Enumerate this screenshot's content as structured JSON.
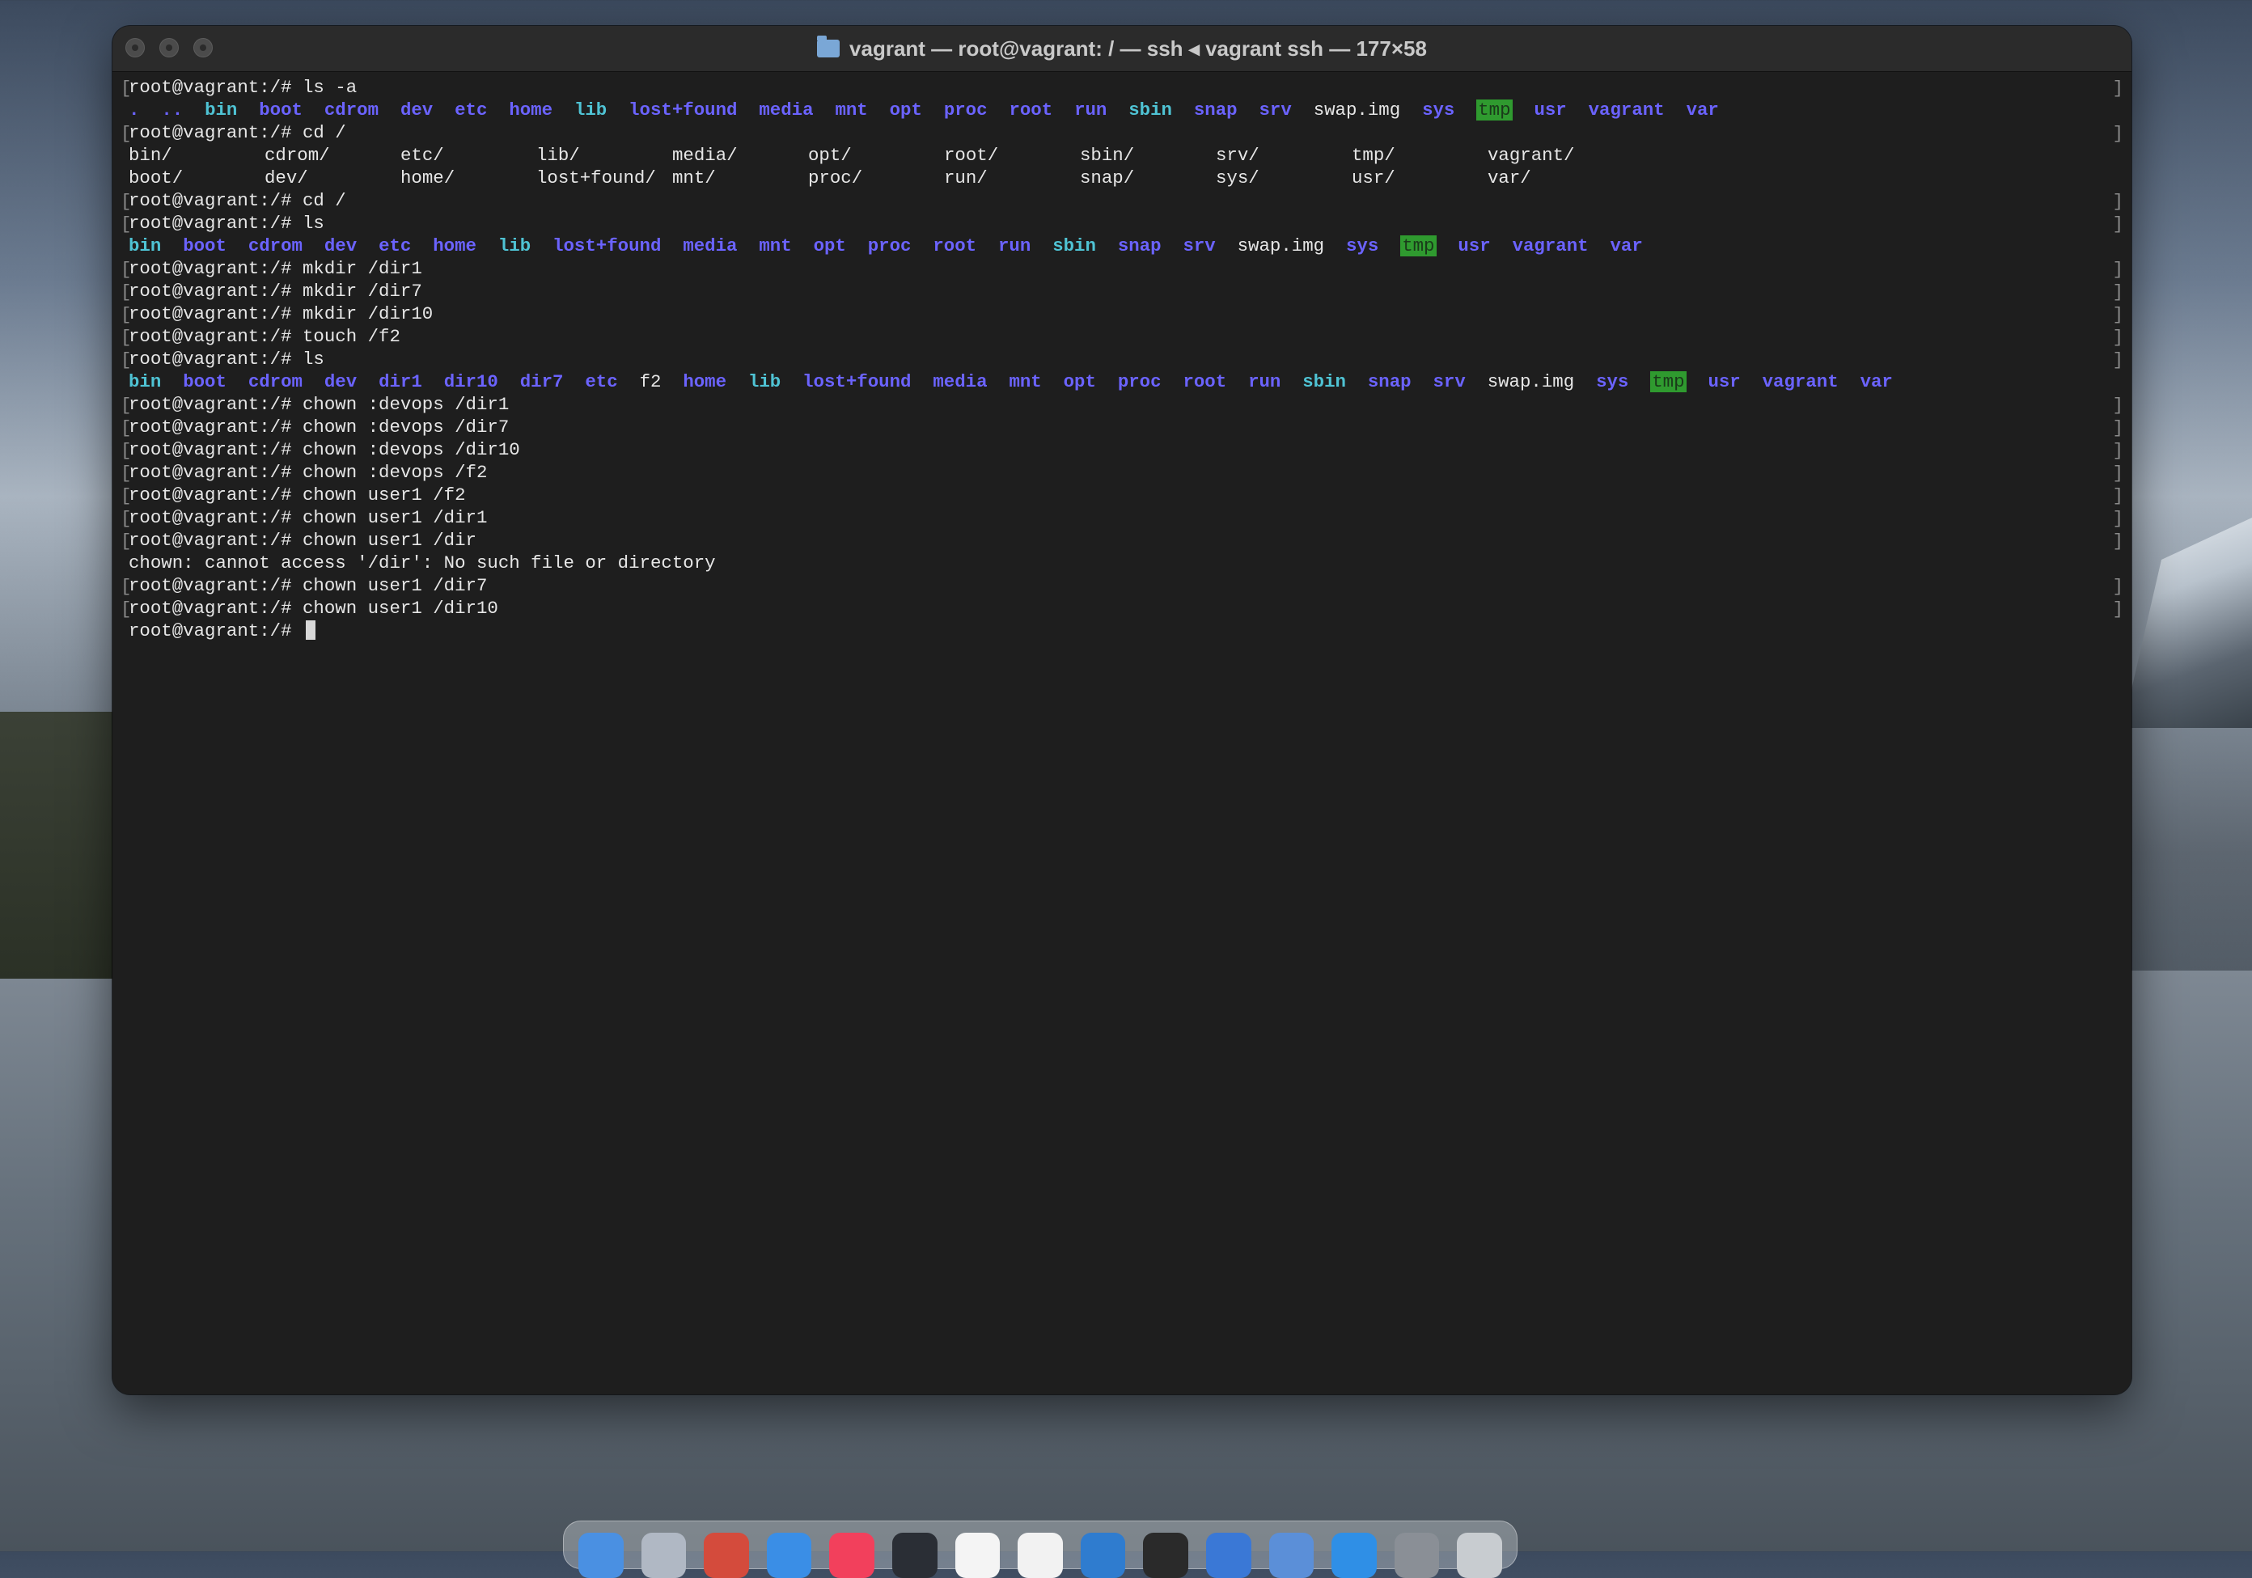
{
  "window": {
    "title": "vagrant — root@vagrant: / — ssh ◂ vagrant ssh — 177×58"
  },
  "terminal": {
    "lines": [
      {
        "text": "root@vagrant:/# ls -a"
      },
      {
        "entries": [
          {
            "t": ".",
            "c": "dir"
          },
          {
            "t": "..",
            "c": "dir"
          },
          {
            "t": "bin",
            "c": "cy"
          },
          {
            "t": "boot",
            "c": "dir"
          },
          {
            "t": "cdrom",
            "c": "dir"
          },
          {
            "t": "dev",
            "c": "dir"
          },
          {
            "t": "etc",
            "c": "dir"
          },
          {
            "t": "home",
            "c": "dir"
          },
          {
            "t": "lib",
            "c": "cy"
          },
          {
            "t": "lost+found",
            "c": "dir"
          },
          {
            "t": "media",
            "c": "dir"
          },
          {
            "t": "mnt",
            "c": "dir"
          },
          {
            "t": "opt",
            "c": "dir"
          },
          {
            "t": "proc",
            "c": "dir"
          },
          {
            "t": "root",
            "c": "dir"
          },
          {
            "t": "run",
            "c": "dir"
          },
          {
            "t": "sbin",
            "c": "cy"
          },
          {
            "t": "snap",
            "c": "dir"
          },
          {
            "t": "srv",
            "c": "dir"
          },
          {
            "t": "swap.img",
            "c": "pl"
          },
          {
            "t": "sys",
            "c": "dir"
          },
          {
            "t": "tmp",
            "c": "hl"
          },
          {
            "t": "usr",
            "c": "dir"
          },
          {
            "t": "vagrant",
            "c": "dir"
          },
          {
            "t": "var",
            "c": "dir"
          }
        ]
      },
      {
        "text": "root@vagrant:/# cd /"
      },
      {
        "columns": [
          "bin/",
          "cdrom/",
          "etc/",
          "lib/",
          "media/",
          "opt/",
          "root/",
          "sbin/",
          "srv/",
          "tmp/",
          "vagrant/"
        ]
      },
      {
        "columns": [
          "boot/",
          "dev/",
          "home/",
          "lost+found/",
          "mnt/",
          "proc/",
          "run/",
          "snap/",
          "sys/",
          "usr/",
          "var/"
        ]
      },
      {
        "text": "root@vagrant:/# cd /"
      },
      {
        "text": "root@vagrant:/# ls"
      },
      {
        "entries": [
          {
            "t": "bin",
            "c": "cy"
          },
          {
            "t": "boot",
            "c": "dir"
          },
          {
            "t": "cdrom",
            "c": "dir"
          },
          {
            "t": "dev",
            "c": "dir"
          },
          {
            "t": "etc",
            "c": "dir"
          },
          {
            "t": "home",
            "c": "dir"
          },
          {
            "t": "lib",
            "c": "cy"
          },
          {
            "t": "lost+found",
            "c": "dir"
          },
          {
            "t": "media",
            "c": "dir"
          },
          {
            "t": "mnt",
            "c": "dir"
          },
          {
            "t": "opt",
            "c": "dir"
          },
          {
            "t": "proc",
            "c": "dir"
          },
          {
            "t": "root",
            "c": "dir"
          },
          {
            "t": "run",
            "c": "dir"
          },
          {
            "t": "sbin",
            "c": "cy"
          },
          {
            "t": "snap",
            "c": "dir"
          },
          {
            "t": "srv",
            "c": "dir"
          },
          {
            "t": "swap.img",
            "c": "pl"
          },
          {
            "t": "sys",
            "c": "dir"
          },
          {
            "t": "tmp",
            "c": "hl"
          },
          {
            "t": "usr",
            "c": "dir"
          },
          {
            "t": "vagrant",
            "c": "dir"
          },
          {
            "t": "var",
            "c": "dir"
          }
        ]
      },
      {
        "text": "root@vagrant:/# mkdir /dir1"
      },
      {
        "text": "root@vagrant:/# mkdir /dir7"
      },
      {
        "text": "root@vagrant:/# mkdir /dir10"
      },
      {
        "text": "root@vagrant:/# touch /f2"
      },
      {
        "text": "root@vagrant:/# ls"
      },
      {
        "entries": [
          {
            "t": "bin",
            "c": "cy"
          },
          {
            "t": "boot",
            "c": "dir"
          },
          {
            "t": "cdrom",
            "c": "dir"
          },
          {
            "t": "dev",
            "c": "dir"
          },
          {
            "t": "dir1",
            "c": "dir"
          },
          {
            "t": "dir10",
            "c": "dir"
          },
          {
            "t": "dir7",
            "c": "dir"
          },
          {
            "t": "etc",
            "c": "dir"
          },
          {
            "t": "f2",
            "c": "pl"
          },
          {
            "t": "home",
            "c": "dir"
          },
          {
            "t": "lib",
            "c": "cy"
          },
          {
            "t": "lost+found",
            "c": "dir"
          },
          {
            "t": "media",
            "c": "dir"
          },
          {
            "t": "mnt",
            "c": "dir"
          },
          {
            "t": "opt",
            "c": "dir"
          },
          {
            "t": "proc",
            "c": "dir"
          },
          {
            "t": "root",
            "c": "dir"
          },
          {
            "t": "run",
            "c": "dir"
          },
          {
            "t": "sbin",
            "c": "cy"
          },
          {
            "t": "snap",
            "c": "dir"
          },
          {
            "t": "srv",
            "c": "dir"
          },
          {
            "t": "swap.img",
            "c": "pl"
          },
          {
            "t": "sys",
            "c": "dir"
          },
          {
            "t": "tmp",
            "c": "hl"
          },
          {
            "t": "usr",
            "c": "dir"
          },
          {
            "t": "vagrant",
            "c": "dir"
          },
          {
            "t": "var",
            "c": "dir"
          }
        ]
      },
      {
        "text": "root@vagrant:/# chown :devops /dir1"
      },
      {
        "text": "root@vagrant:/# chown :devops /dir7"
      },
      {
        "text": "root@vagrant:/# chown :devops /dir10"
      },
      {
        "text": "root@vagrant:/# chown :devops /f2"
      },
      {
        "text": "root@vagrant:/# chown user1 /f2"
      },
      {
        "text": "root@vagrant:/# chown user1 /dir1"
      },
      {
        "text": "root@vagrant:/# chown user1 /dir"
      },
      {
        "text": "chown: cannot access '/dir': No such file or directory",
        "nomark": true
      },
      {
        "text": "root@vagrant:/# chown user1 /dir7"
      },
      {
        "text": "root@vagrant:/# chown user1 /dir10"
      }
    ],
    "prompt": "root@vagrant:/# "
  },
  "colors": {
    "directory": "#6b63ff",
    "link": "#4fc3d4",
    "tmp_highlight": "#2f9a2f",
    "terminal_bg": "#1e1e1e"
  },
  "dock": {
    "icons": [
      "finder-icon",
      "launchpad-icon",
      "chrome-icon",
      "safari-icon",
      "music-icon",
      "stocks-icon",
      "textedit-icon",
      "notes-icon",
      "vscode-icon",
      "terminal-icon",
      "xcode-icon",
      "files-icon",
      "xcode2-icon",
      "settings-icon",
      "trash-icon"
    ]
  }
}
